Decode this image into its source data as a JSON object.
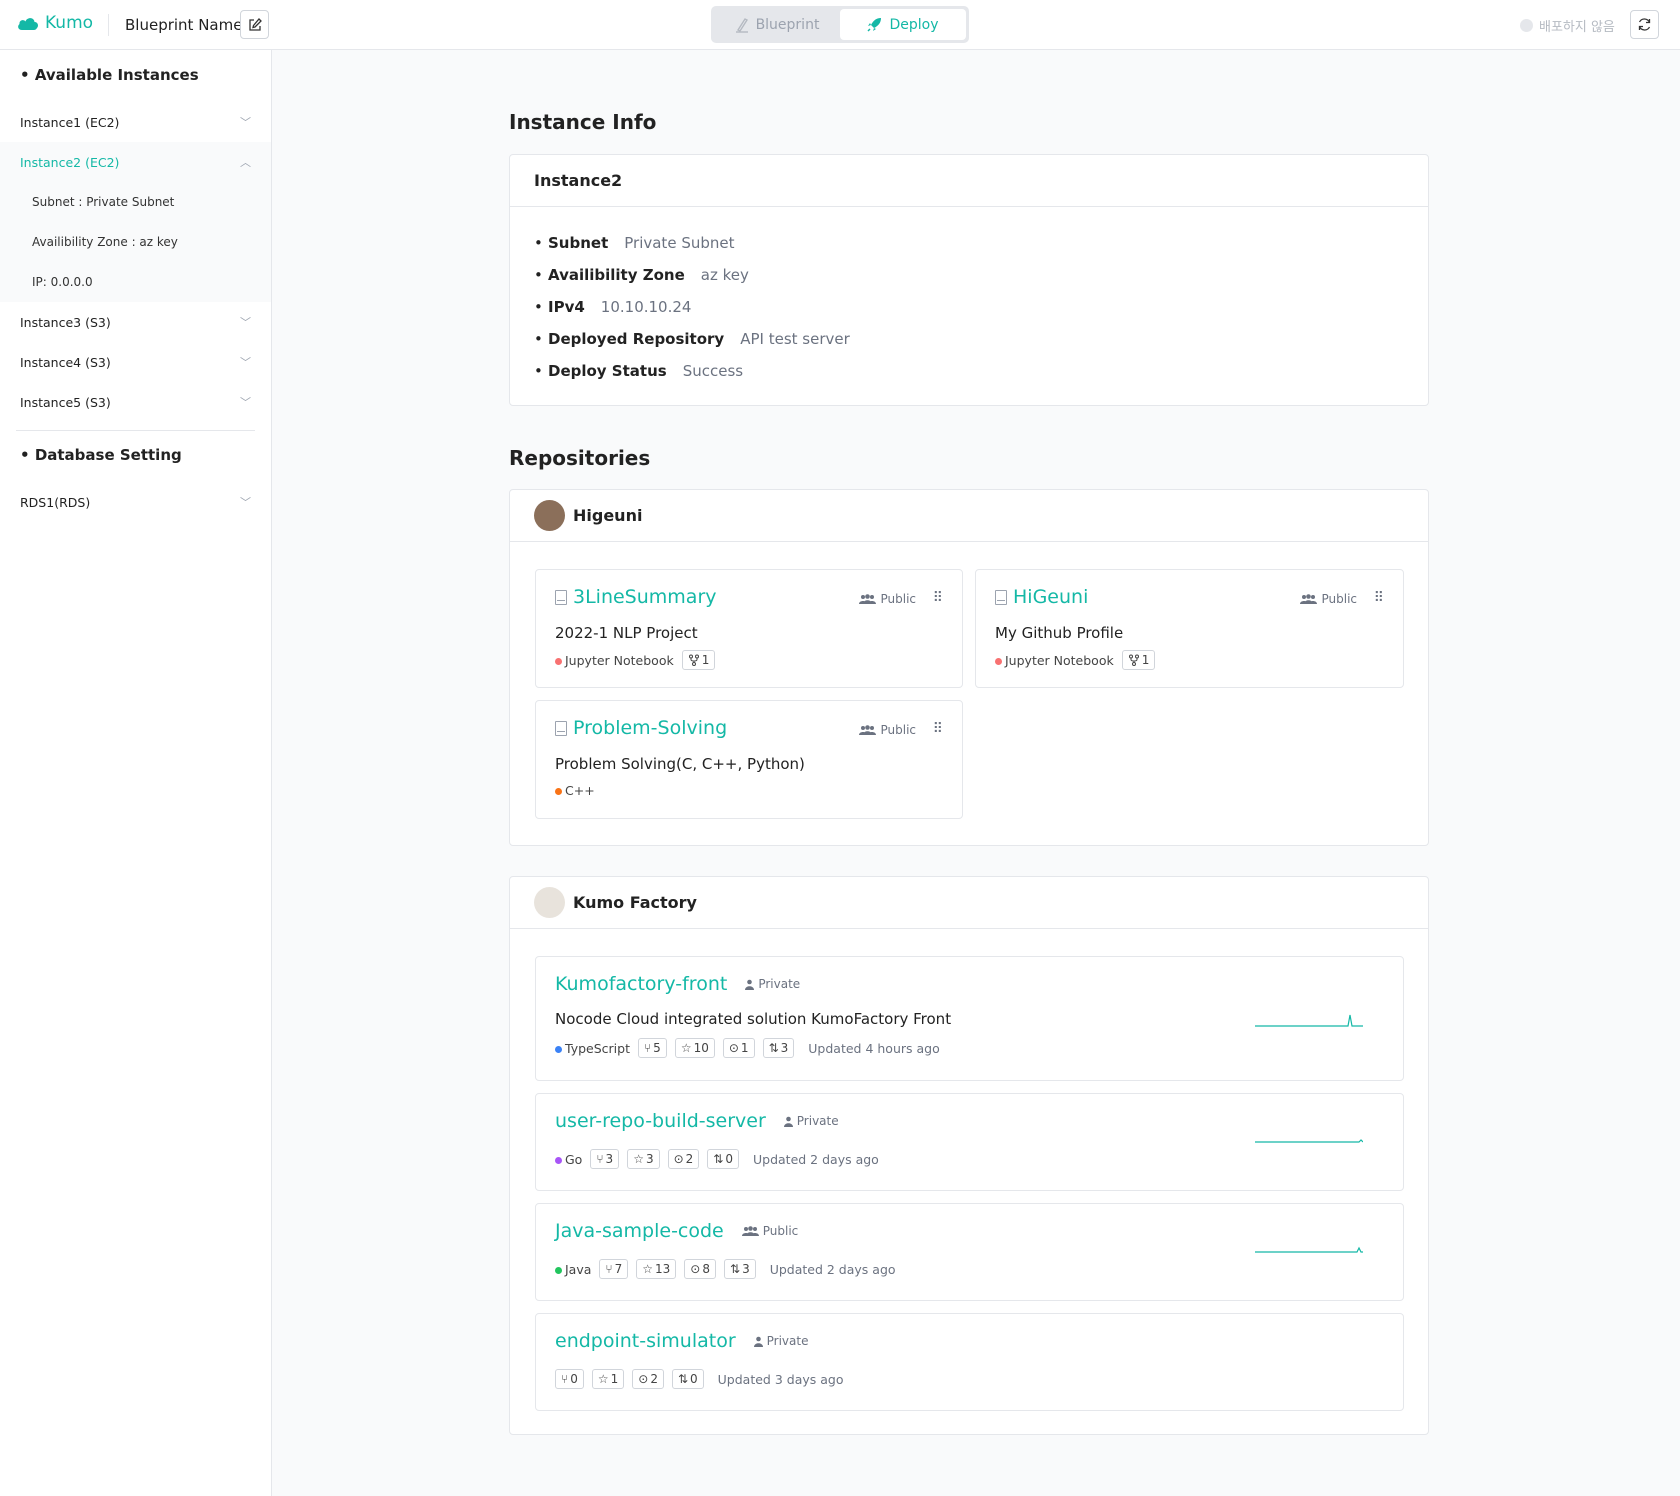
{
  "header": {
    "logo_text": "Kumo",
    "blueprint_name": "Blueprint Name",
    "tabs": [
      {
        "label": "Blueprint",
        "active": false
      },
      {
        "label": "Deploy",
        "active": true
      }
    ],
    "deploy_status": "배포하지 않음",
    "accent_color": "#14b8a6"
  },
  "sidebar": {
    "instances_heading": "Available Instances",
    "instances": [
      {
        "label": "Instance1 (EC2)",
        "expanded": false
      },
      {
        "label": "Instance2 (EC2)",
        "expanded": true
      },
      {
        "label": "Instance3 (S3)",
        "expanded": false
      },
      {
        "label": "Instance4 (S3)",
        "expanded": false
      },
      {
        "label": "Instance5 (S3)",
        "expanded": false
      }
    ],
    "expanded_details": [
      "Subnet : Private Subnet",
      "Availibility Zone : az key",
      "IP: 0.0.0.0"
    ],
    "database_heading": "Database Setting",
    "databases": [
      {
        "label": "RDS1(RDS)",
        "expanded": false
      }
    ]
  },
  "instance_info": {
    "section_title": "Instance Info",
    "name": "Instance2",
    "fields": [
      {
        "key": "Subnet",
        "value": "Private Subnet"
      },
      {
        "key": "Availibility Zone",
        "value": "az key"
      },
      {
        "key": "IPv4",
        "value": "10.10.10.24"
      },
      {
        "key": "Deployed Repository",
        "value": "API test server"
      },
      {
        "key": "Deploy Status",
        "value": "Success"
      }
    ]
  },
  "repositories": {
    "section_title": "Repositories",
    "higeuni": {
      "owner": "Higeuni",
      "repos": [
        {
          "name": "3LineSummary",
          "visibility": "Public",
          "description": "2022-1 NLP Project",
          "language": "Jupyter Notebook",
          "language_color": "#f87171",
          "forks": "1"
        },
        {
          "name": "HiGeuni",
          "visibility": "Public",
          "description": "My Github Profile",
          "language": "Jupyter Notebook",
          "language_color": "#f87171",
          "forks": "1"
        },
        {
          "name": "Problem-Solving",
          "visibility": "Public",
          "description": "Problem Solving(C, C++, Python)",
          "language": "C++",
          "language_color": "#f97316"
        }
      ]
    },
    "kumo": {
      "owner": "Kumo Factory",
      "repos": [
        {
          "name": "Kumofactory-front",
          "visibility": "Private",
          "description": "Nocode Cloud integrated solution KumoFactory Front",
          "language": "TypeScript",
          "language_color": "#3b82f6",
          "forks": "5",
          "stars": "10",
          "issues": "1",
          "prs": "3",
          "updated": "Updated 4 hours ago"
        },
        {
          "name": "user-repo-build-server",
          "visibility": "Private",
          "language": "Go",
          "language_color": "#a855f7",
          "forks": "3",
          "stars": "3",
          "issues": "2",
          "prs": "0",
          "updated": "Updated 2 days ago"
        },
        {
          "name": "Java-sample-code",
          "visibility": "Public",
          "language": "Java",
          "language_color": "#22c55e",
          "forks": "7",
          "stars": "13",
          "issues": "8",
          "prs": "3",
          "updated": "Updated 2 days ago"
        },
        {
          "name": "endpoint-simulator",
          "visibility": "Private",
          "forks": "0",
          "stars": "1",
          "issues": "2",
          "prs": "0",
          "updated": "Updated 3 days ago"
        }
      ]
    }
  }
}
